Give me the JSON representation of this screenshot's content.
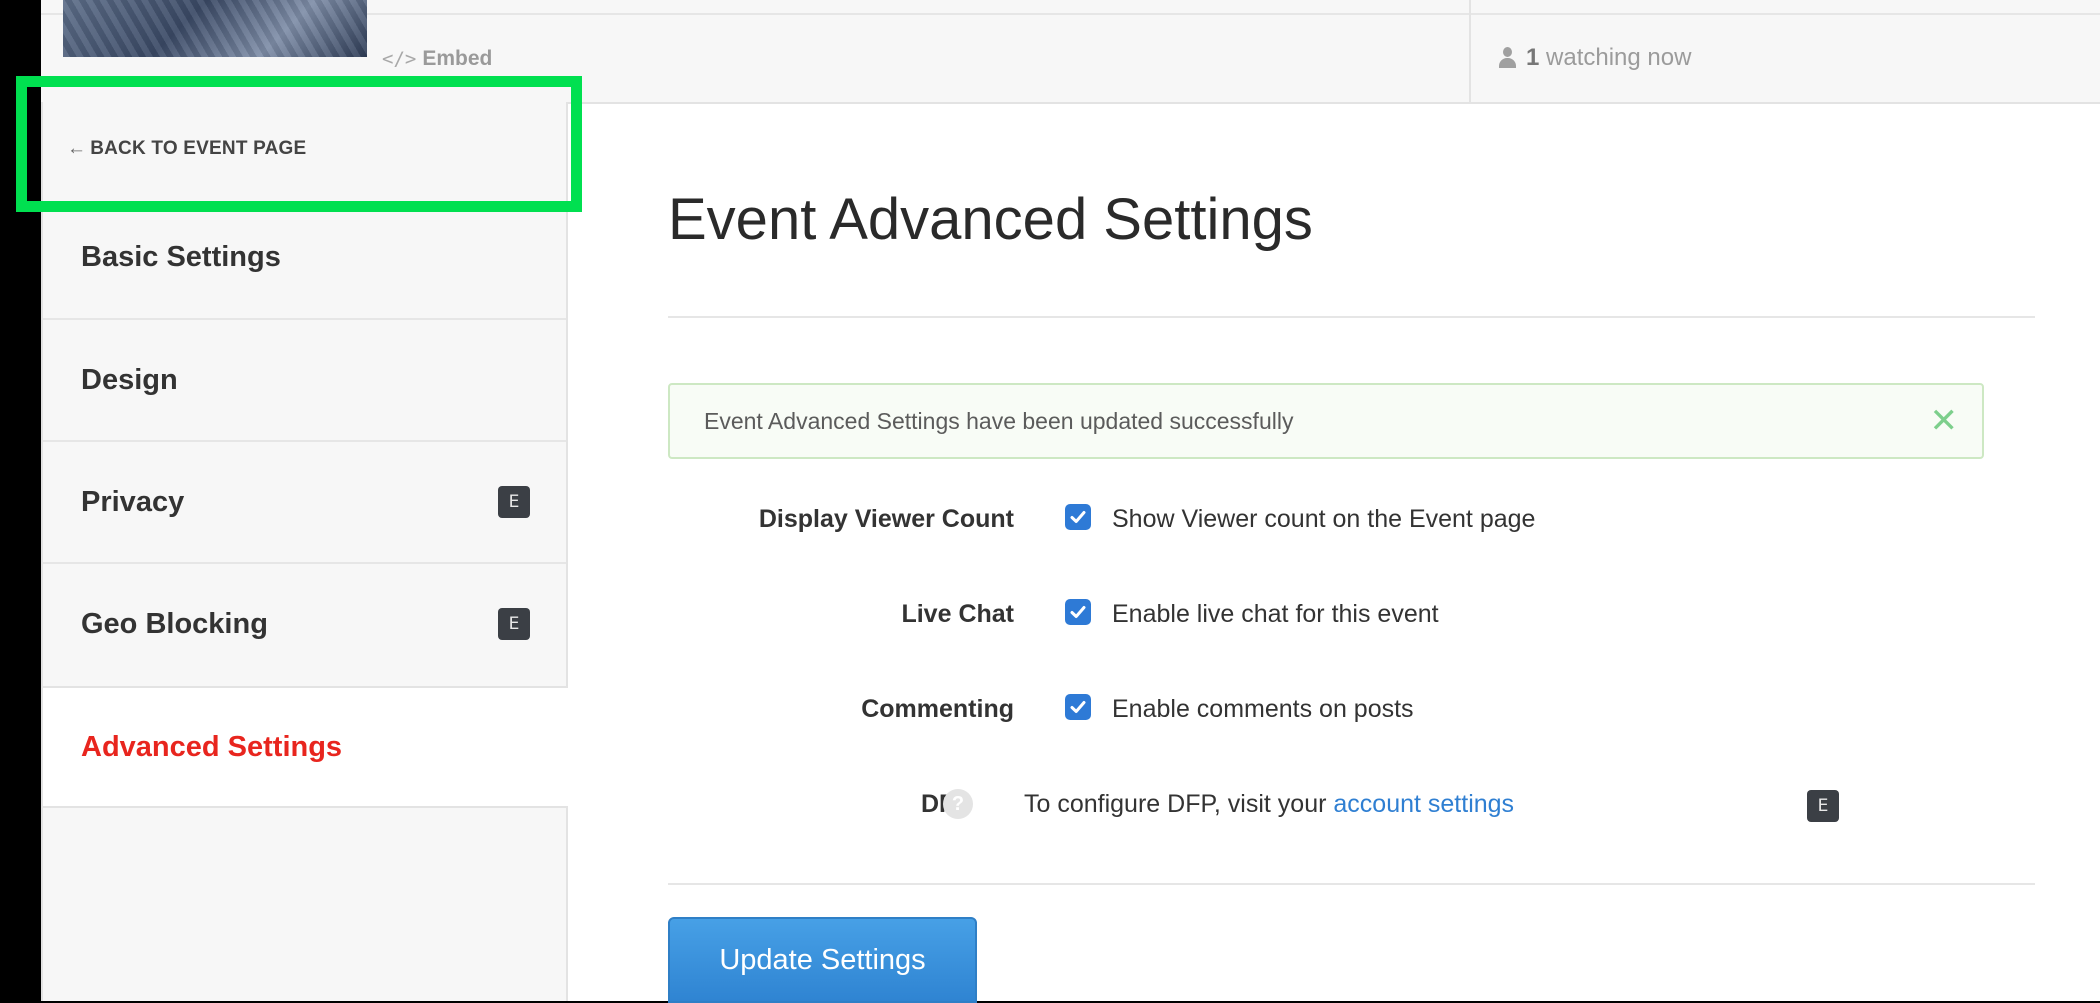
{
  "header": {
    "embed_label": "Embed",
    "embed_glyph": "</>",
    "watching_count": "1",
    "watching_text": "watching now"
  },
  "sidebar": {
    "back_label": "BACK TO EVENT PAGE",
    "back_arrow": "←",
    "items": [
      {
        "label": "Basic Settings",
        "badge": ""
      },
      {
        "label": "Design",
        "badge": ""
      },
      {
        "label": "Privacy",
        "badge": "E"
      },
      {
        "label": "Geo Blocking",
        "badge": "E"
      },
      {
        "label": "Advanced Settings",
        "badge": "",
        "active": true
      }
    ]
  },
  "main": {
    "title": "Event Advanced Settings",
    "alert_text": "Event Advanced Settings have been updated successfully",
    "alert_close": "✕",
    "settings": [
      {
        "label": "Display Viewer Count",
        "text": "Show Viewer count on the Event page",
        "checked": true
      },
      {
        "label": "Live Chat",
        "text": "Enable live chat for this event",
        "checked": true
      },
      {
        "label": "Commenting",
        "text": "Enable comments on posts",
        "checked": true
      }
    ],
    "dfp": {
      "label": "DFP",
      "help": "?",
      "text_before": "To configure DFP, visit your ",
      "link_text": "account settings",
      "badge": "E"
    },
    "update_button": "Update Settings"
  },
  "colors": {
    "accent_active": "#e8251e",
    "primary_button": "#3a8fd8",
    "highlight": "#00e050",
    "success_border": "#cde8c3"
  }
}
